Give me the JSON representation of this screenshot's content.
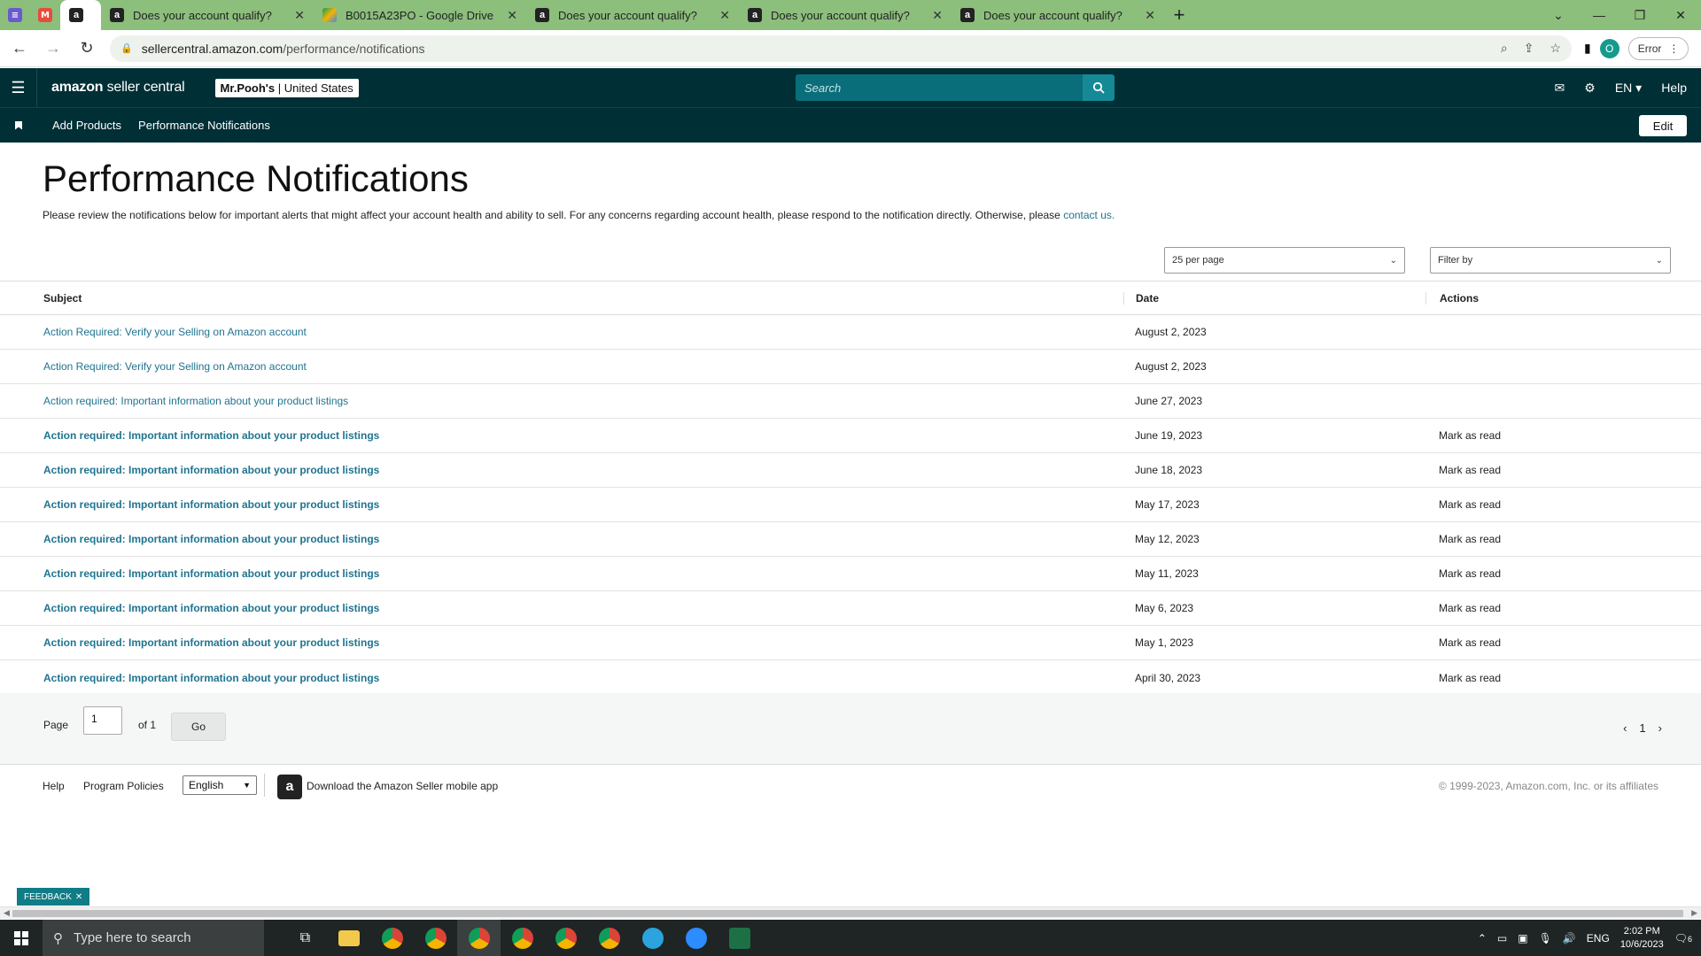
{
  "browser": {
    "tabs": [
      {
        "title": "Does your account qualify?"
      },
      {
        "title": "B0015A23PO - Google Drive"
      },
      {
        "title": "Does your account qualify?"
      },
      {
        "title": "Does your account qualify?"
      },
      {
        "title": "Does your account qualify?"
      }
    ],
    "url_host": "sellercentral.amazon.com",
    "url_path": "/performance/notifications",
    "profile_initial": "O",
    "error_label": "Error"
  },
  "header": {
    "logo_bold": "amazon",
    "logo_thin": " seller central",
    "store_name": "Mr.Pooh's",
    "store_region": "United States",
    "search_placeholder": "Search",
    "language": "EN",
    "help": "Help"
  },
  "nav": {
    "items": [
      "Add Products",
      "Performance Notifications"
    ],
    "edit": "Edit"
  },
  "page": {
    "title": "Performance Notifications",
    "description": "Please review the notifications below for important alerts that might affect your account health and ability to sell. For any concerns regarding account health, please respond to the notification directly. Otherwise, please ",
    "contact_link": "contact us.",
    "per_page": "25 per page",
    "filter": "Filter by"
  },
  "table": {
    "headers": {
      "subject": "Subject",
      "date": "Date",
      "actions": "Actions"
    },
    "rows": [
      {
        "subject": "Action Required: Verify your Selling on Amazon account",
        "date": "August 2, 2023",
        "action": "",
        "unread": false
      },
      {
        "subject": "Action Required: Verify your Selling on Amazon account",
        "date": "August 2, 2023",
        "action": "",
        "unread": false
      },
      {
        "subject": "Action required: Important information about your product listings",
        "date": "June 27, 2023",
        "action": "",
        "unread": false
      },
      {
        "subject": "Action required: Important information about your product listings",
        "date": "June 19, 2023",
        "action": "Mark as read",
        "unread": true
      },
      {
        "subject": "Action required: Important information about your product listings",
        "date": "June 18, 2023",
        "action": "Mark as read",
        "unread": true
      },
      {
        "subject": "Action required: Important information about your product listings",
        "date": "May 17, 2023",
        "action": "Mark as read",
        "unread": true
      },
      {
        "subject": "Action required: Important information about your product listings",
        "date": "May 12, 2023",
        "action": "Mark as read",
        "unread": true
      },
      {
        "subject": "Action required: Important information about your product listings",
        "date": "May 11, 2023",
        "action": "Mark as read",
        "unread": true
      },
      {
        "subject": "Action required: Important information about your product listings",
        "date": "May 6, 2023",
        "action": "Mark as read",
        "unread": true
      },
      {
        "subject": "Action required: Important information about your product listings",
        "date": "May 1, 2023",
        "action": "Mark as read",
        "unread": true
      },
      {
        "subject": "Action required: Important information about your product listings",
        "date": "April 30, 2023",
        "action": "Mark as read",
        "unread": true
      }
    ]
  },
  "pager": {
    "page_label": "Page",
    "page_value": "1",
    "of_label": "of 1",
    "go": "Go",
    "prev": "‹",
    "current": "1",
    "next": "›"
  },
  "footer": {
    "help": "Help",
    "policies": "Program Policies",
    "language": "English",
    "app_link": "Download the Amazon Seller mobile app",
    "copyright": "© 1999-2023, Amazon.com, Inc. or its affiliates"
  },
  "feedback": "FEEDBACK",
  "taskbar": {
    "search_placeholder": "Type here to search",
    "lang": "ENG",
    "time": "2:02 PM",
    "date": "10/6/2023",
    "notification_count": "6"
  },
  "colors": {
    "header_bg": "#002f36",
    "link": "#1f7490",
    "tabstrip": "#8cbe7c"
  }
}
